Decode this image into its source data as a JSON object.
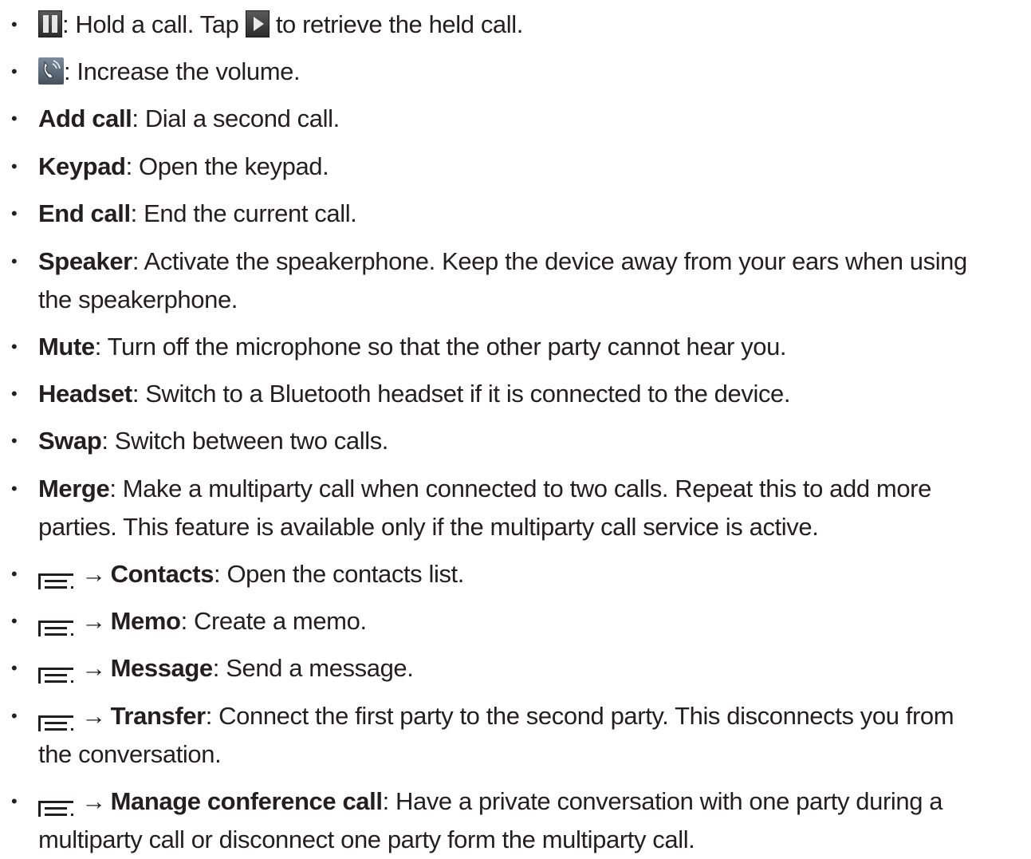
{
  "bullet_char": "•",
  "arrow_char": "→",
  "items": [
    {
      "icon": "hold-icon",
      "icon2": "play-icon",
      "text1": ": Hold a call. Tap ",
      "text2": " to retrieve the held call."
    },
    {
      "icon": "volume-boost-icon",
      "text": ": Increase the volume."
    },
    {
      "term": "Add call",
      "desc": ": Dial a second call."
    },
    {
      "term": "Keypad",
      "desc": ": Open the keypad."
    },
    {
      "term": "End call",
      "desc": ": End the current call."
    },
    {
      "term": "Speaker",
      "desc": ": Activate the speakerphone. Keep the device away from your ears when using",
      "desc2": "the speakerphone."
    },
    {
      "term": "Mute",
      "desc": ": Turn off the microphone so that the other party cannot hear you."
    },
    {
      "term": "Headset",
      "desc": ": Switch to a Bluetooth headset if it is connected to the device."
    },
    {
      "term": "Swap",
      "desc": ": Switch between two calls."
    },
    {
      "term": "Merge",
      "desc": ": Make a multiparty call when connected to two calls. Repeat this to add more",
      "desc2": "parties. This feature is available only if the multiparty call service is active."
    },
    {
      "icon": "menu-icon",
      "term": "Contacts",
      "desc": ": Open the contacts list."
    },
    {
      "icon": "menu-icon",
      "term": "Memo",
      "desc": ": Create a memo."
    },
    {
      "icon": "menu-icon",
      "term": "Message",
      "desc": ": Send a message."
    },
    {
      "icon": "menu-icon",
      "term": "Transfer",
      "desc": ": Connect the first party to the second party. This disconnects you from",
      "desc2": "the conversation."
    },
    {
      "icon": "menu-icon",
      "term": "Manage conference call",
      "desc": ": Have a private conversation with one party during a",
      "desc2": "multiparty call or disconnect one party form the multiparty call."
    }
  ]
}
